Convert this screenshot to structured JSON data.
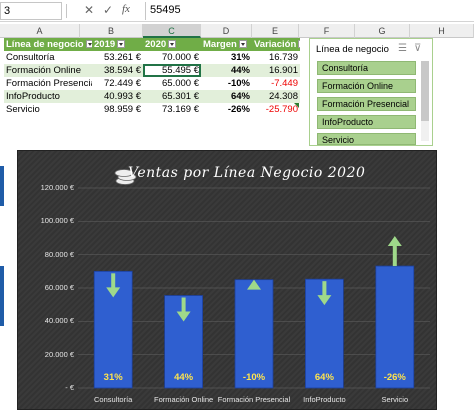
{
  "namebox": "3",
  "formula": "55495",
  "columns": [
    "A",
    "B",
    "C",
    "D",
    "E",
    "F",
    "G",
    "H"
  ],
  "table": {
    "headers": [
      "Línea de negocio",
      "2019",
      "2020",
      "Margen",
      "Variación"
    ],
    "rows": [
      {
        "name": "Consultoría",
        "y2019": "53.261 €",
        "y2020": "70.000 €",
        "margen": "31%",
        "var": "16.739",
        "neg": false
      },
      {
        "name": "Formación Online",
        "y2019": "38.594 €",
        "y2020": "55.495 €",
        "margen": "44%",
        "var": "16.901",
        "neg": false
      },
      {
        "name": "Formación Presencial",
        "y2019": "72.449 €",
        "y2020": "65.000 €",
        "margen": "-10%",
        "var": "-7.449",
        "neg": true
      },
      {
        "name": "InfoProducto",
        "y2019": "40.993 €",
        "y2020": "65.301 €",
        "margen": "64%",
        "var": "24.308",
        "neg": false
      },
      {
        "name": "Servicio",
        "y2019": "98.959 €",
        "y2020": "73.169 €",
        "margen": "-26%",
        "var": "-25.790",
        "neg": true
      }
    ]
  },
  "slicer": {
    "title": "Línea de negocio",
    "items": [
      "Consultoría",
      "Formación Online",
      "Formación Presencial",
      "InfoProducto",
      "Servicio"
    ]
  },
  "colors": {
    "bar": "#2f5fd0",
    "bar_light": "#4a7be6",
    "arrow": "#9fd98a",
    "header_green": "#70ad47",
    "pct_label": "#ffe44d"
  },
  "chart_data": {
    "type": "bar",
    "title": "Ventas por Línea Negocio 2020",
    "categories": [
      "Consultoría",
      "Formación Online",
      "Formación Presencial",
      "InfoProducto",
      "Servicio"
    ],
    "values": [
      70000,
      55495,
      65000,
      65301,
      73169
    ],
    "data_labels": [
      "31%",
      "44%",
      "-10%",
      "64%",
      "-26%"
    ],
    "arrows": [
      "down",
      "down",
      "up",
      "down",
      "up"
    ],
    "ylim": [
      0,
      120000
    ],
    "yticks": [
      "120.000 €",
      "100.000 €",
      "80.000 €",
      "60.000 €",
      "40.000 €",
      "20.000 €",
      "- €"
    ],
    "grid": true,
    "xlabel": "",
    "ylabel": ""
  }
}
